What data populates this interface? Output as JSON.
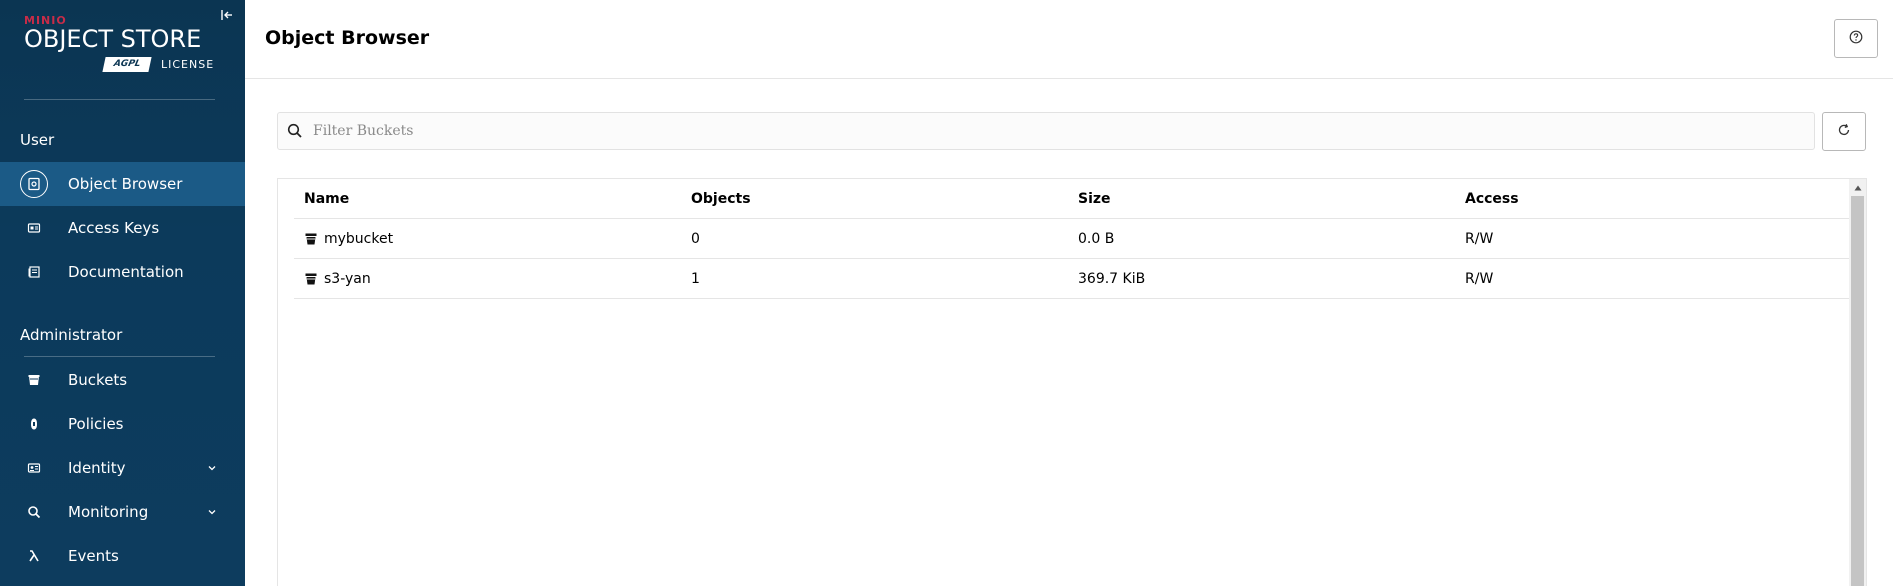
{
  "app": {
    "brand": "MINIO",
    "product": "OBJECT STORE",
    "license_badge": "AGPL",
    "license_word": "LICENSE"
  },
  "sidebar": {
    "sections": [
      {
        "label": "User"
      },
      {
        "label": "Administrator"
      }
    ],
    "items": [
      {
        "label": "Object Browser",
        "icon": "object-browser-icon",
        "active": true
      },
      {
        "label": "Access Keys",
        "icon": "access-keys-icon"
      },
      {
        "label": "Documentation",
        "icon": "documentation-icon"
      },
      {
        "label": "Buckets",
        "icon": "bucket-icon"
      },
      {
        "label": "Policies",
        "icon": "policies-icon"
      },
      {
        "label": "Identity",
        "icon": "identity-icon",
        "expandable": true
      },
      {
        "label": "Monitoring",
        "icon": "monitoring-icon",
        "expandable": true
      },
      {
        "label": "Events",
        "icon": "lambda-icon"
      }
    ]
  },
  "header": {
    "title": "Object Browser"
  },
  "filter": {
    "placeholder": "Filter Buckets",
    "value": ""
  },
  "table": {
    "columns": [
      "Name",
      "Objects",
      "Size",
      "Access"
    ],
    "rows": [
      {
        "name": "mybucket",
        "objects": "0",
        "size": "0.0 B",
        "access": "R/W"
      },
      {
        "name": "s3-yan",
        "objects": "1",
        "size": "369.7 KiB",
        "access": "R/W"
      }
    ]
  },
  "colors": {
    "sidebar_bg": "#0c3a5b",
    "sidebar_active": "#1b5a86",
    "brand_red": "#c72c48"
  }
}
